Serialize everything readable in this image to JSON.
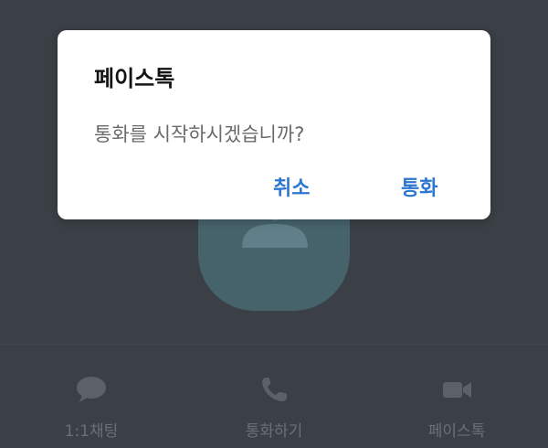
{
  "dialog": {
    "title": "페이스톡",
    "message": "통화를 시작하시겠습니까?",
    "cancel_label": "취소",
    "confirm_label": "통화"
  },
  "nav": {
    "items": [
      {
        "label": "1:1채팅",
        "icon": "chat-bubble-icon"
      },
      {
        "label": "통화하기",
        "icon": "phone-icon"
      },
      {
        "label": "페이스톡",
        "icon": "video-camera-icon"
      }
    ]
  },
  "colors": {
    "background": "#3b4046",
    "avatar": "#46636c",
    "accent": "#2e77d0",
    "nav_inactive": "#6b7076"
  }
}
